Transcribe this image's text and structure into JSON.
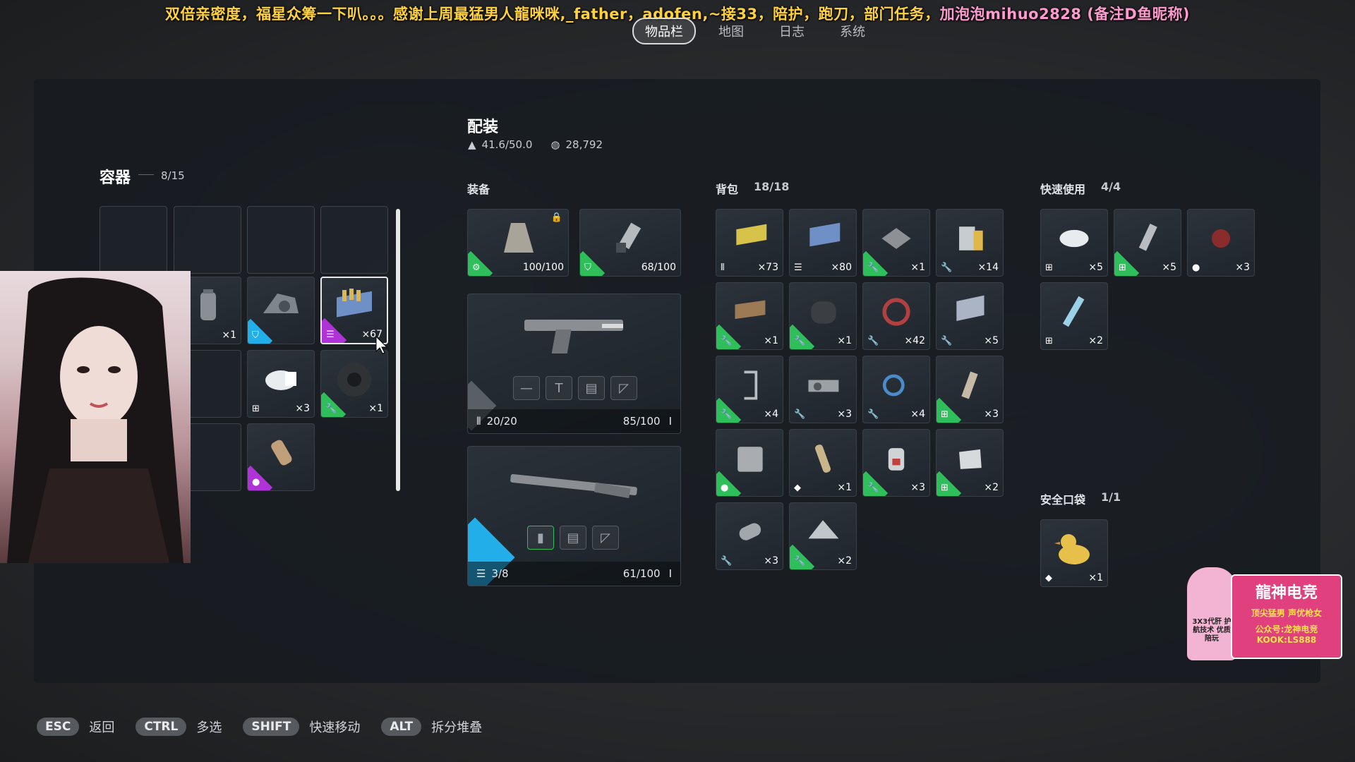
{
  "banner": {
    "part1": "双倍亲密度，福星众筹一下叭。。。感谢上周最猛男人龍咪咪,_father，adofen,~接33，陪护，跑刀，部门任务，",
    "part2": "加泡泡mihuo2828 (备注D鱼昵称)"
  },
  "nav": {
    "tabs": [
      "物品栏",
      "地图",
      "日志",
      "系统"
    ],
    "active": "物品栏"
  },
  "container": {
    "title": "容器",
    "count": "8/15"
  },
  "loadout": {
    "title": "配装",
    "weight": "41.6/50.0",
    "currency": "28,792"
  },
  "equipment": {
    "label": "装备",
    "armor": {
      "durability": "100/100"
    },
    "helmet": {
      "durability": "68/100"
    },
    "primary": {
      "ammo": "20/20",
      "durability": "85/100"
    },
    "secondary": {
      "ammo": "3/8",
      "durability": "61/100"
    }
  },
  "backpack": {
    "label": "背包",
    "count": "18/18"
  },
  "quick_use": {
    "label": "快速使用",
    "count": "4/4"
  },
  "safe_pocket": {
    "label": "安全口袋",
    "count": "1/1"
  },
  "container_items": [
    {
      "qty": "×1",
      "rarity": "none"
    },
    {
      "qty": "",
      "rarity": "blue"
    },
    {
      "qty": "×67",
      "rarity": "purple"
    },
    {
      "qty": "×3",
      "rarity": "none"
    },
    {
      "qty": "×1",
      "rarity": "green"
    },
    {
      "qty": "",
      "rarity": "purple"
    }
  ],
  "backpack_items": [
    {
      "qty": "×73",
      "rarity": "none"
    },
    {
      "qty": "×80",
      "rarity": "none"
    },
    {
      "qty": "×1",
      "rarity": "green"
    },
    {
      "qty": "×14",
      "rarity": "none"
    },
    {
      "qty": "×1",
      "rarity": "green"
    },
    {
      "qty": "×1",
      "rarity": "green"
    },
    {
      "qty": "×42",
      "rarity": "none"
    },
    {
      "qty": "×5",
      "rarity": "none"
    },
    {
      "qty": "×4",
      "rarity": "green"
    },
    {
      "qty": "×3",
      "rarity": "none"
    },
    {
      "qty": "×4",
      "rarity": "none"
    },
    {
      "qty": "×3",
      "rarity": "green"
    },
    {
      "qty": "",
      "rarity": "green"
    },
    {
      "qty": "×1",
      "rarity": "none"
    },
    {
      "qty": "×3",
      "rarity": "green"
    },
    {
      "qty": "×2",
      "rarity": "green"
    },
    {
      "qty": "×3",
      "rarity": "none"
    },
    {
      "qty": "×2",
      "rarity": "green"
    }
  ],
  "quick_items": [
    {
      "qty": "×5",
      "rarity": "none"
    },
    {
      "qty": "×5",
      "rarity": "green"
    },
    {
      "qty": "×3",
      "rarity": "none"
    },
    {
      "qty": "×2",
      "rarity": "none"
    }
  ],
  "safe_items": [
    {
      "qty": "×1",
      "rarity": "none"
    }
  ],
  "hotkeys": [
    {
      "key": "ESC",
      "label": "返回"
    },
    {
      "key": "CTRL",
      "label": "多选"
    },
    {
      "key": "SHIFT",
      "label": "快速移动"
    },
    {
      "key": "ALT",
      "label": "拆分堆叠"
    }
  ],
  "logo": {
    "title": "龍神电竞",
    "line1": "顶尖猛男 声优枪女",
    "line2": "公众号:龙神电竞",
    "line3": "KOOK:LS888",
    "badge": "3X3代肝 护航技术 优质陪玩"
  }
}
